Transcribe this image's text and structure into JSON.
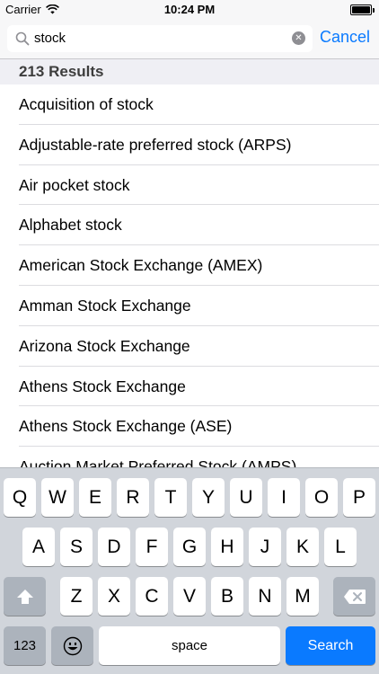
{
  "status_bar": {
    "carrier": "Carrier",
    "time": "10:24 PM"
  },
  "search": {
    "value": "stock",
    "cancel_label": "Cancel"
  },
  "results": {
    "header": "213 Results",
    "items": [
      "Acquisition of stock",
      "Adjustable-rate preferred stock (ARPS)",
      "Air pocket stock",
      "Alphabet stock",
      "American Stock Exchange (AMEX)",
      "Amman Stock Exchange",
      "Arizona Stock Exchange",
      "Athens Stock Exchange",
      "Athens Stock Exchange (ASE)",
      "Auction Market Preferred Stock (AMPS)"
    ]
  },
  "keyboard": {
    "row1": [
      "Q",
      "W",
      "E",
      "R",
      "T",
      "Y",
      "U",
      "I",
      "O",
      "P"
    ],
    "row2": [
      "A",
      "S",
      "D",
      "F",
      "G",
      "H",
      "J",
      "K",
      "L"
    ],
    "row3": [
      "Z",
      "X",
      "C",
      "V",
      "B",
      "N",
      "M"
    ],
    "numbers_label": "123",
    "space_label": "space",
    "search_label": "Search"
  }
}
